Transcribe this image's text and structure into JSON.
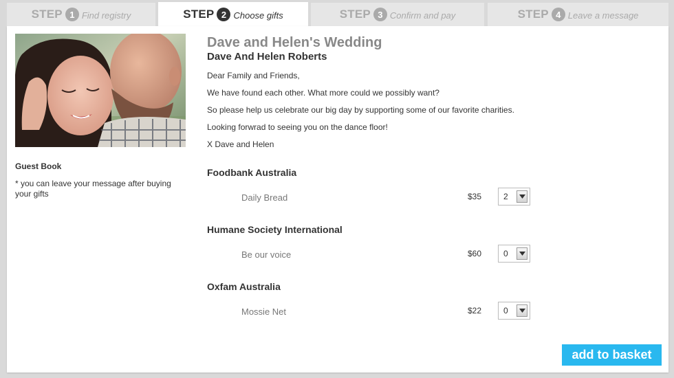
{
  "steps": [
    {
      "word": "STEP",
      "number": "1",
      "label": "Find registry",
      "active": false
    },
    {
      "word": "STEP",
      "number": "2",
      "label": "Choose gifts",
      "active": true
    },
    {
      "word": "STEP",
      "number": "3",
      "label": "Confirm and pay",
      "active": false
    },
    {
      "word": "STEP",
      "number": "4",
      "label": "Leave a message",
      "active": false
    }
  ],
  "sidebar": {
    "guestbook_title": "Guest Book",
    "guestbook_note": "* you can leave your message after buying your gifts"
  },
  "event": {
    "title": "Dave and Helen's Wedding",
    "couple": "Dave And Helen Roberts",
    "message": [
      "Dear Family and Friends,",
      "We have found each other. What more could we possibly want?",
      "So please help us celebrate our big day by supporting some of our favorite charities.",
      "Looking forwrad to seeing you on the dance floor!",
      "X Dave and Helen"
    ]
  },
  "charities": [
    {
      "name": "Foodbank Australia",
      "gift": "Daily Bread",
      "price": "$35",
      "qty": "2"
    },
    {
      "name": "Humane Society International",
      "gift": "Be our voice",
      "price": "$60",
      "qty": "0"
    },
    {
      "name": "Oxfam Australia",
      "gift": "Mossie Net",
      "price": "$22",
      "qty": "0"
    }
  ],
  "actions": {
    "add_to_basket": "add to basket"
  },
  "colors": {
    "accent": "#29b8ef",
    "active_tab": "#ffffff",
    "inactive_tab": "#e6e6e6",
    "page_bg": "#d9d9d9"
  }
}
